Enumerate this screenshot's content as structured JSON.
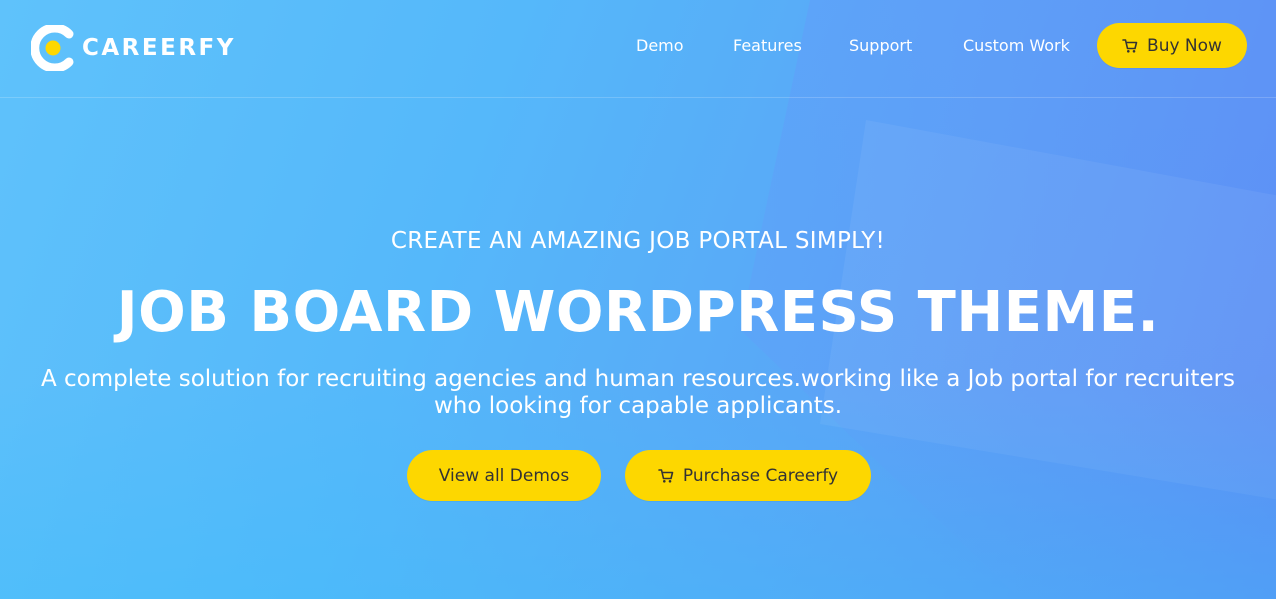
{
  "brand": {
    "name": "CAREERFY",
    "logo_icon": "c-ring-logo-icon",
    "colors": {
      "accent": "#fdd700",
      "logo_dot": "#fdd700",
      "text": "#ffffff",
      "button_text": "#333333"
    }
  },
  "nav": {
    "items": [
      {
        "label": "Demo"
      },
      {
        "label": "Features"
      },
      {
        "label": "Support"
      },
      {
        "label": "Custom Work"
      }
    ],
    "buy_now": {
      "label": "Buy Now",
      "icon": "cart-icon"
    }
  },
  "hero": {
    "eyebrow": "CREATE AN AMAZING JOB PORTAL SIMPLY!",
    "title": "JOB BOARD WORDPRESS THEME.",
    "description": "A complete solution for recruiting agencies and human resources.working like a Job portal for recruiters who looking for capable applicants.",
    "buttons": {
      "view_demos": {
        "label": "View all Demos"
      },
      "purchase": {
        "label": "Purchase Careerfy",
        "icon": "cart-icon"
      }
    }
  }
}
